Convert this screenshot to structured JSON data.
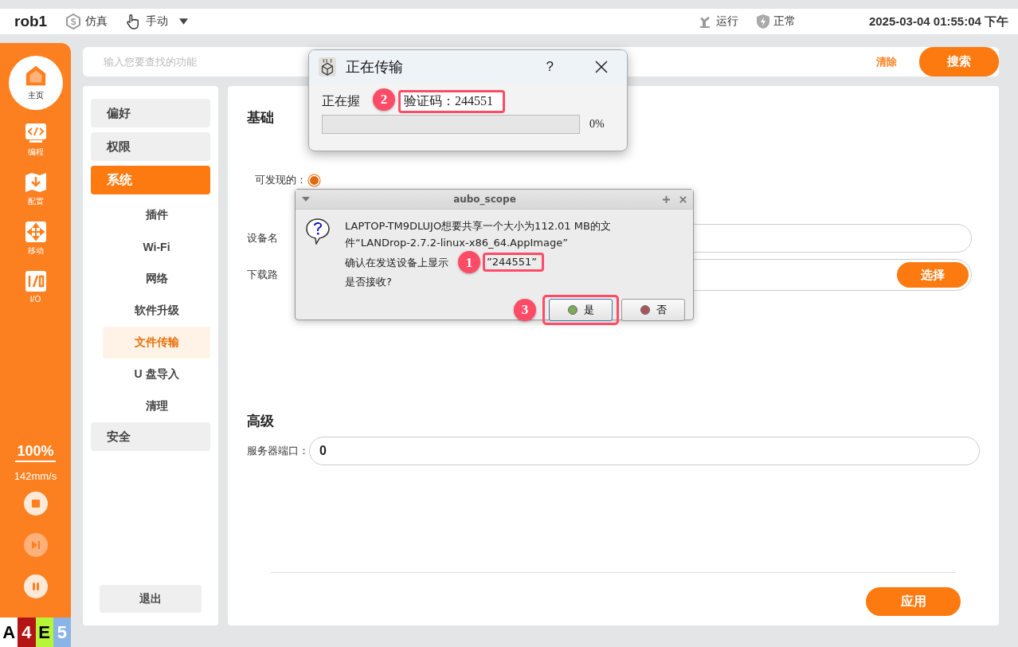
{
  "top_bar": {
    "robot": "rob1",
    "mode_sim": "仿真",
    "mode_manual": "手动",
    "status_run": "运行",
    "status_safety": "正常",
    "datetime": "2025-03-04 01:55:04 下午"
  },
  "sidebar": {
    "items": [
      {
        "kind": "home",
        "label": "主页",
        "selected": true
      },
      {
        "kind": "code",
        "label": "编程",
        "selected": false
      },
      {
        "kind": "config",
        "label": "配置",
        "selected": false
      },
      {
        "kind": "move",
        "label": "移动",
        "selected": false
      },
      {
        "kind": "io",
        "label": "I/O",
        "selected": false
      }
    ],
    "speed_percent": "100%",
    "speed": "142mm/s",
    "controls": [
      {
        "kind": "stop",
        "disabled": false
      },
      {
        "kind": "step",
        "disabled": true
      },
      {
        "kind": "pause",
        "disabled": false
      }
    ],
    "legend": [
      {
        "label": "A",
        "color": "#ffffff"
      },
      {
        "label": "4",
        "color": "#b41414"
      },
      {
        "label": "E",
        "color": "#b6f53a"
      },
      {
        "label": "5",
        "color": "#8ab4e6"
      }
    ]
  },
  "search": {
    "placeholder": "输入您要查找的功能",
    "clear": "清除",
    "submit": "搜索"
  },
  "menu": {
    "items": [
      {
        "label": "偏好",
        "selected": false
      },
      {
        "label": "权限",
        "selected": false
      },
      {
        "label": "系统",
        "selected": true,
        "children": [
          {
            "label": "插件",
            "selected": false
          },
          {
            "label": "Wi-Fi",
            "selected": false
          },
          {
            "label": "网络",
            "selected": false
          },
          {
            "label": "软件升级",
            "selected": false
          },
          {
            "label": "文件传输",
            "selected": true
          },
          {
            "label": "U 盘导入",
            "selected": false
          },
          {
            "label": "清理",
            "selected": false
          }
        ]
      },
      {
        "label": "安全",
        "selected": false
      }
    ],
    "exit": "退出"
  },
  "settings": {
    "basic_title": "基础",
    "discoverable": {
      "label": "可发现的：",
      "checked": true
    },
    "device_name": {
      "label": "设备名"
    },
    "download_path": {
      "label": "下载路",
      "button": "选择"
    },
    "advanced_title": "高级",
    "server_port": {
      "label": "服务器端口：",
      "value": "0"
    },
    "apply": "应用"
  },
  "transfer_dialog": {
    "title": "正在传输",
    "help": "?",
    "status": "正在握",
    "callout": "2",
    "code": "验证码：244551",
    "level": 0,
    "percent": "0%"
  },
  "confirm_dialog": {
    "title": "aubo_scope",
    "lines": [
      "LAPTOP-TM9DLUJO想要共享一个大小为112.01 MB的文",
      "件“LANDrop-2.7.2-linux-x86_64.AppImage”"
    ],
    "confirm_prefix": "确认在发送设备上显示",
    "callout_code": "1",
    "code": "”244551”",
    "question": "是否接收?",
    "callout_button": "3",
    "yes": "是",
    "no": "否"
  }
}
